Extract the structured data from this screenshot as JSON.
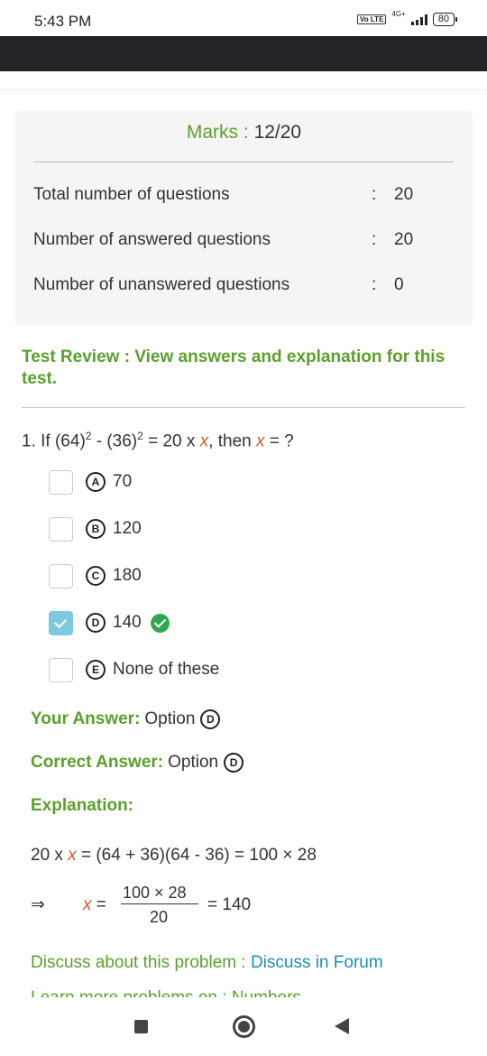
{
  "status_bar": {
    "time": "5:43 PM",
    "volte": "Vo LTE",
    "network": "4G+",
    "battery": "80"
  },
  "summary": {
    "marks_label": "Marks :",
    "marks_value": "12/20",
    "rows": [
      {
        "label": "Total number of questions",
        "colon": ":",
        "value": "20"
      },
      {
        "label": "Number of answered questions",
        "colon": ":",
        "value": "20"
      },
      {
        "label": "Number of unanswered questions",
        "colon": ":",
        "value": "0"
      }
    ]
  },
  "review_heading": "Test Review : View answers and explanation for this test.",
  "question": {
    "number": "1.",
    "text_if": "If (64)",
    "exp1": "2",
    "text_minus": " - (36)",
    "exp2": "2",
    "text_eq": " = 20 x ",
    "var": "x",
    "text_then": ", then ",
    "var2": "x",
    "text_end": " = ?",
    "options": [
      {
        "letter": "A",
        "text": "70",
        "checked": false,
        "correct": false
      },
      {
        "letter": "B",
        "text": "120",
        "checked": false,
        "correct": false
      },
      {
        "letter": "C",
        "text": "180",
        "checked": false,
        "correct": false
      },
      {
        "letter": "D",
        "text": "140",
        "checked": true,
        "correct": true
      },
      {
        "letter": "E",
        "text": "None of these",
        "checked": false,
        "correct": false
      }
    ]
  },
  "your_answer": {
    "label": "Your Answer:",
    "text": "Option",
    "letter": "D"
  },
  "correct_answer": {
    "label": "Correct Answer:",
    "text": "Option",
    "letter": "D"
  },
  "explanation": {
    "title": "Explanation:",
    "eq1_prefix": "20 x ",
    "eq1_var": "x",
    "eq1_rest": " = (64 + 36)(64 - 36) = 100 × 28",
    "implies": "⇒",
    "eq2_var": "x",
    "eq2_eq": " =",
    "frac_num": "100 × 28",
    "frac_den": "20",
    "eq2_result": "= 140"
  },
  "discuss": {
    "text": "Discuss about this problem : ",
    "link": "Discuss in Forum"
  },
  "learn_more": "Learn more problems on : Numbers",
  "colors": {
    "accent_green": "#5aa02c",
    "link_blue": "#1c8fb3",
    "checked_blue": "#7ec9e0",
    "correct_green": "#2fa84f"
  }
}
